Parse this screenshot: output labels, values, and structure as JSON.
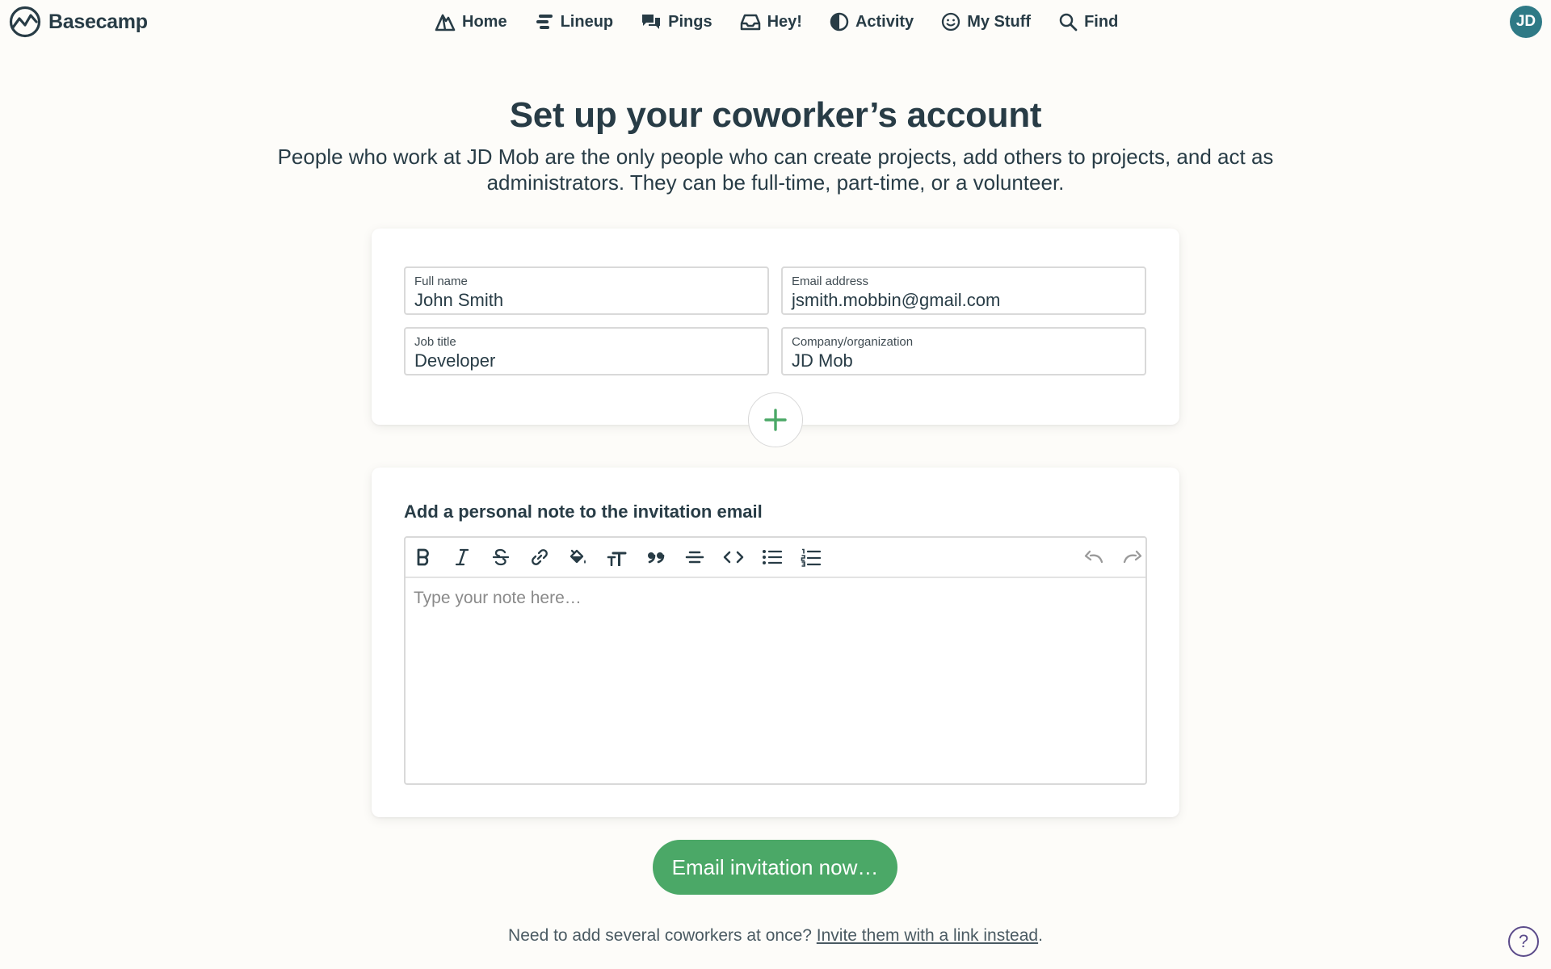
{
  "header": {
    "brand_name": "Basecamp",
    "nav": {
      "home": "Home",
      "lineup": "Lineup",
      "pings": "Pings",
      "hey": "Hey!",
      "activity": "Activity",
      "my_stuff": "My Stuff",
      "find": "Find"
    },
    "avatar_initials": "JD",
    "avatar_color": "#2f7a86"
  },
  "page": {
    "title": "Set up your coworker’s account",
    "description": "People who work at JD Mob are the only people who can create projects, add others to projects, and act as administrators. They can be full-time, part-time, or a volunteer."
  },
  "form": {
    "full_name": {
      "label": "Full name",
      "value": "John Smith"
    },
    "email": {
      "label": "Email address",
      "value": "jsmith.mobbin@gmail.com"
    },
    "job_title": {
      "label": "Job title",
      "value": "Developer"
    },
    "company": {
      "label": "Company/organization",
      "value": "JD Mob"
    },
    "add_person_icon": "plus-icon"
  },
  "note": {
    "heading": "Add a personal note to the invitation email",
    "placeholder": "Type your note here…",
    "toolbar": [
      "bold",
      "italic",
      "strikethrough",
      "link",
      "highlight",
      "text-size",
      "quote",
      "horizontal-rule",
      "code",
      "bulleted-list",
      "numbered-list",
      "undo",
      "redo"
    ]
  },
  "actions": {
    "submit_label": "Email invitation now…",
    "submit_color": "#4ba867"
  },
  "footer": {
    "prefix": "Need to add several coworkers at once?",
    "link_label": "Invite them with a link instead",
    "suffix": ".",
    "help_label": "?"
  }
}
